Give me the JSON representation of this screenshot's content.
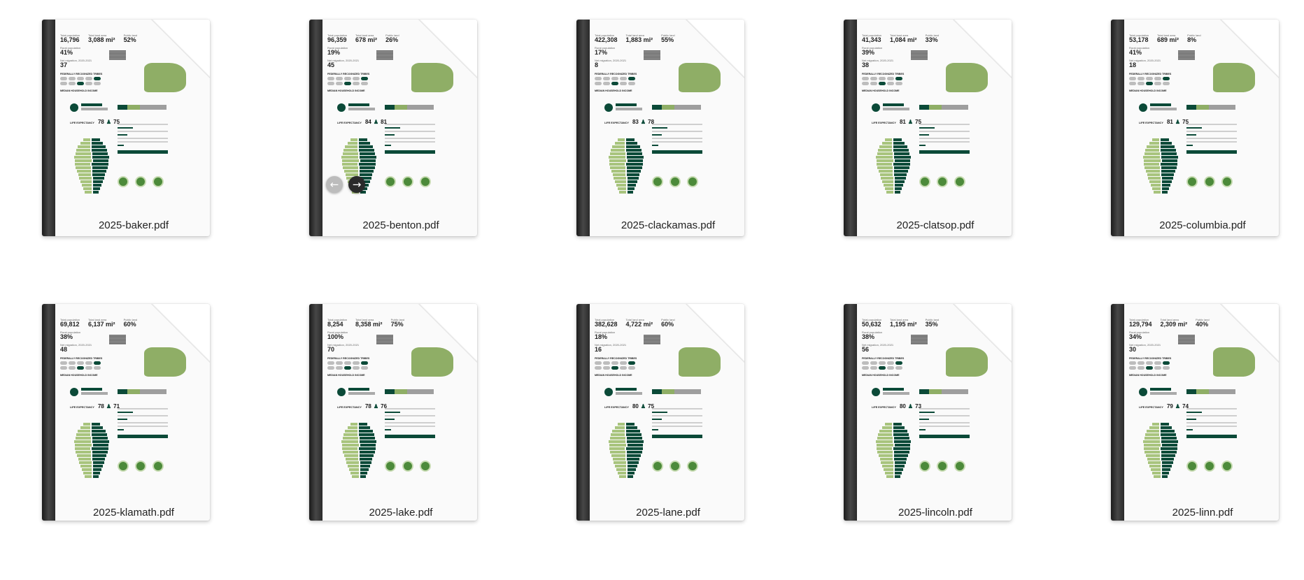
{
  "files": [
    {
      "name": "2025-baker.pdf",
      "population": "16,796",
      "area": "3,088 mi²",
      "public_land": "52%",
      "rural": "41%",
      "migration": "37",
      "life_f": "78",
      "life_m": "75"
    },
    {
      "name": "2025-benton.pdf",
      "population": "96,359",
      "area": "678 mi²",
      "public_land": "26%",
      "rural": "19%",
      "migration": "45",
      "life_f": "84",
      "life_m": "81",
      "has_nav": true
    },
    {
      "name": "2025-clackamas.pdf",
      "population": "422,308",
      "area": "1,883 mi²",
      "public_land": "55%",
      "rural": "17%",
      "migration": "8",
      "life_f": "83",
      "life_m": "78"
    },
    {
      "name": "2025-clatsop.pdf",
      "population": "41,343",
      "area": "1,084 mi²",
      "public_land": "33%",
      "rural": "39%",
      "migration": "38",
      "life_f": "81",
      "life_m": "75"
    },
    {
      "name": "2025-columbia.pdf",
      "population": "53,178",
      "area": "689 mi²",
      "public_land": "8%",
      "rural": "41%",
      "migration": "18",
      "life_f": "81",
      "life_m": "75"
    },
    {
      "name": "2025-klamath.pdf",
      "population": "69,812",
      "area": "6,137 mi²",
      "public_land": "60%",
      "rural": "38%",
      "migration": "48",
      "life_f": "78",
      "life_m": "71"
    },
    {
      "name": "2025-lake.pdf",
      "population": "8,254",
      "area": "8,358 mi²",
      "public_land": "75%",
      "rural": "100%",
      "migration": "70",
      "life_f": "78",
      "life_m": "76"
    },
    {
      "name": "2025-lane.pdf",
      "population": "382,628",
      "area": "4,722 mi²",
      "public_land": "60%",
      "rural": "18%",
      "migration": "16",
      "life_f": "80",
      "life_m": "75"
    },
    {
      "name": "2025-lincoln.pdf",
      "population": "50,632",
      "area": "1,195 mi²",
      "public_land": "35%",
      "rural": "38%",
      "migration": "56",
      "life_f": "80",
      "life_m": "73"
    },
    {
      "name": "2025-linn.pdf",
      "population": "129,794",
      "area": "2,309 mi²",
      "public_land": "40%",
      "rural": "34%",
      "migration": "30",
      "life_f": "79",
      "life_m": "74"
    }
  ],
  "labels": {
    "total_population": "Total population",
    "total_land_area": "Total land area",
    "public_land": "Public land",
    "rural_population": "Rural population",
    "net_migration": "Net migration, 2020-2021",
    "tribes": "FEDERALLY RECOGNIZED TRIBES",
    "income": "MEDIAN HOUSEHOLD INCOME",
    "hardship": "HOUSEHOLDS IN FINANCIAL HARDSHIP",
    "life": "LIFE EXPECTANCY",
    "race": "POPULATION BY RACE/ETHNICITY",
    "age": "POPULATION BY AGE",
    "employment": "TOP EMPLOYMENT INDUSTRIES"
  },
  "nav": {
    "prev_icon": "arrow-left-icon",
    "next_icon": "arrow-right-icon",
    "prev_glyph": "←",
    "next_glyph": "→"
  }
}
